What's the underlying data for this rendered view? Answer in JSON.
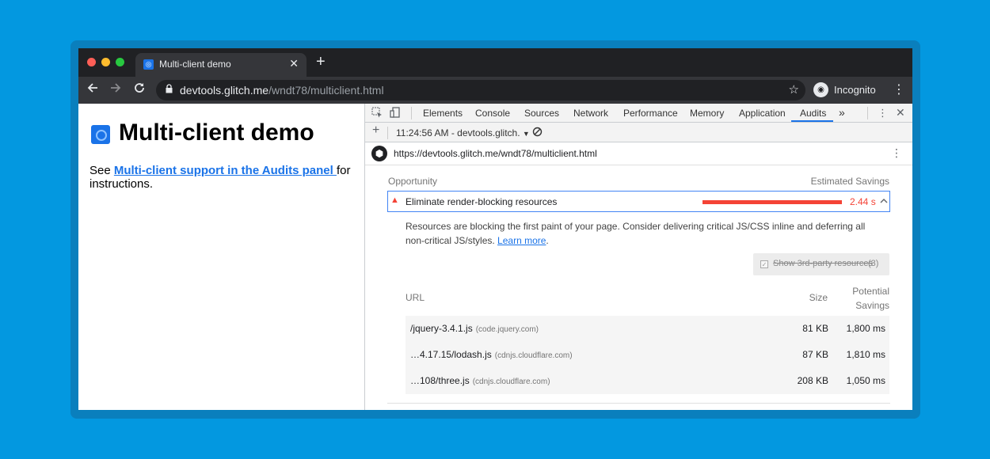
{
  "browser": {
    "tab_title": "Multi-client demo",
    "tab_close": "✕",
    "new_tab": "+",
    "url_host": "devtools.glitch.me",
    "url_path": "/wndt78/multiclient.html",
    "incognito_label": "Incognito"
  },
  "page": {
    "title": "Multi-client demo",
    "text_before": "See ",
    "link_text": "Multi-client support in the Audits panel ",
    "text_after": "for instructions."
  },
  "devtools": {
    "tabs": [
      "Elements",
      "Console",
      "Sources",
      "Network",
      "Performance",
      "Memory",
      "Application",
      "Audits"
    ],
    "active_tab": "Audits",
    "more_tabs": "»",
    "report_selector": "11:24:56 AM - devtools.glitch.",
    "report_url": "https://devtools.glitch.me/wndt78/multiclient.html"
  },
  "report": {
    "opportunity_label": "Opportunity",
    "savings_label": "Estimated Savings",
    "audit": {
      "title": "Eliminate render-blocking resources",
      "value": "2.44 s",
      "status_color": "#f44336",
      "description": "Resources are blocking the first paint of your page. Consider delivering critical JS/CSS inline and deferring all non-critical JS/styles. ",
      "learn_more": "Learn more",
      "description_end": "."
    },
    "third_party": {
      "label": "Show 3rd-party resources",
      "count": "(3)"
    },
    "table": {
      "col_url": "URL",
      "col_size": "Size",
      "col_potential_1": "Potential",
      "col_potential_2": "Savings",
      "rows": [
        {
          "url": "/jquery-3.4.1.js",
          "host": "(code.jquery.com)",
          "size": "81 KB",
          "savings": "1,800 ms"
        },
        {
          "url": "…4.17.15/lodash.js",
          "host": "(cdnjs.cloudflare.com)",
          "size": "87 KB",
          "savings": "1,810 ms"
        },
        {
          "url": "…108/three.js",
          "host": "(cdnjs.cloudflare.com)",
          "size": "208 KB",
          "savings": "1,050 ms"
        }
      ]
    }
  }
}
